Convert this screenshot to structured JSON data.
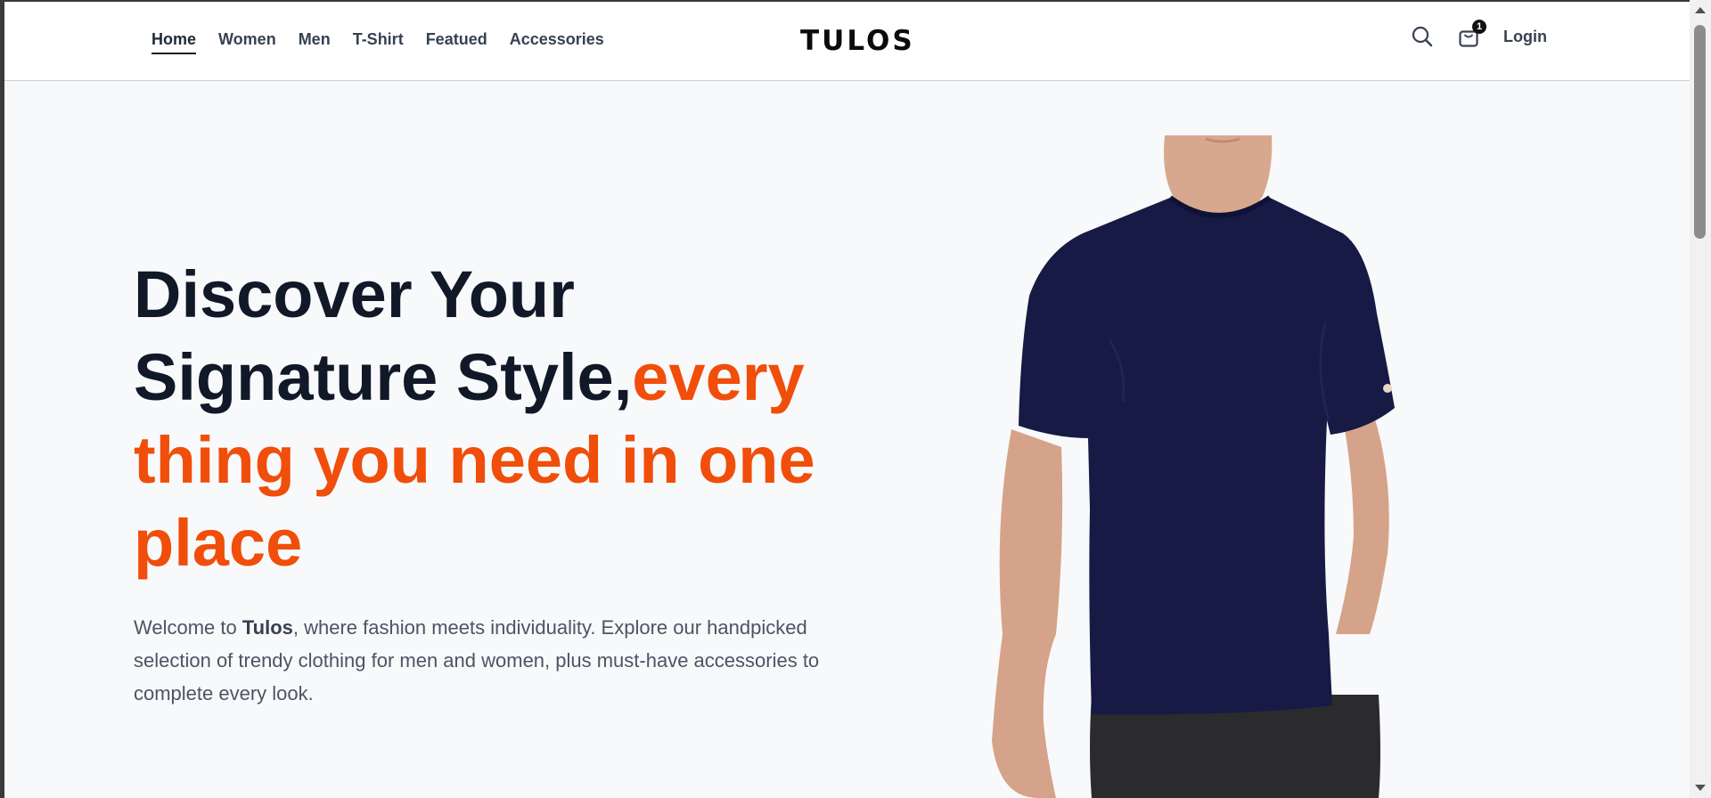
{
  "nav": {
    "links": [
      "Home",
      "Women",
      "Men",
      "T-Shirt",
      "Featued",
      "Accessories"
    ],
    "logo": "TULOS",
    "cart_count": "1",
    "login": "Login"
  },
  "hero": {
    "title_line1": "Discover Your",
    "title_line2_dark": "Signature Style,",
    "title_accent": "every thing you need in one place",
    "desc_before": "Welcome to ",
    "desc_brand": "Tulos",
    "desc_after": ", where fashion meets individuality. Explore our handpicked selection of trendy clothing for men and women, plus must-have accessories to complete every look."
  },
  "colors": {
    "accent": "#f04e0a",
    "heading": "#111827",
    "background": "#f8f9fb"
  },
  "icons": [
    "search-icon",
    "shopping-bag-icon"
  ]
}
